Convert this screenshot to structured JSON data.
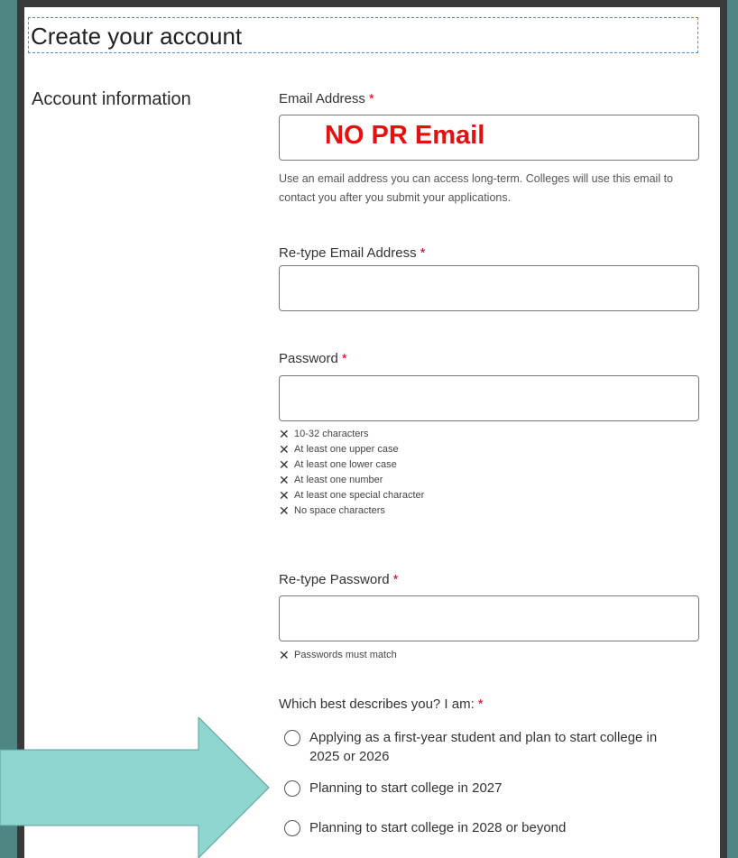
{
  "page": {
    "title": "Create your account",
    "section": "Account information"
  },
  "fields": {
    "email_label": "Email Address",
    "email_value": "NO PR Email",
    "email_help": "Use an email address you can access long-term. Colleges will use this email to contact you after you submit your applications.",
    "retype_email_label": "Re-type Email Address",
    "password_label": "Password",
    "password_rules": [
      "10-32 characters",
      "At least one upper case",
      "At least one lower case",
      "At least one number",
      "At least one special character",
      "No space characters"
    ],
    "retype_password_label": "Re-type Password",
    "match_rule": "Passwords must match",
    "required_mark": "*"
  },
  "question": {
    "label": "Which best describes you? I am:",
    "options": [
      "Applying as a first-year student and plan to start college in 2025 or 2026",
      "Planning to start college in 2027",
      "Planning to start college in 2028 or beyond"
    ]
  },
  "colors": {
    "background": "#4f8583",
    "arrow": "#8fd5d0",
    "emphasis": "#e8100f",
    "required": "#d0021b"
  }
}
